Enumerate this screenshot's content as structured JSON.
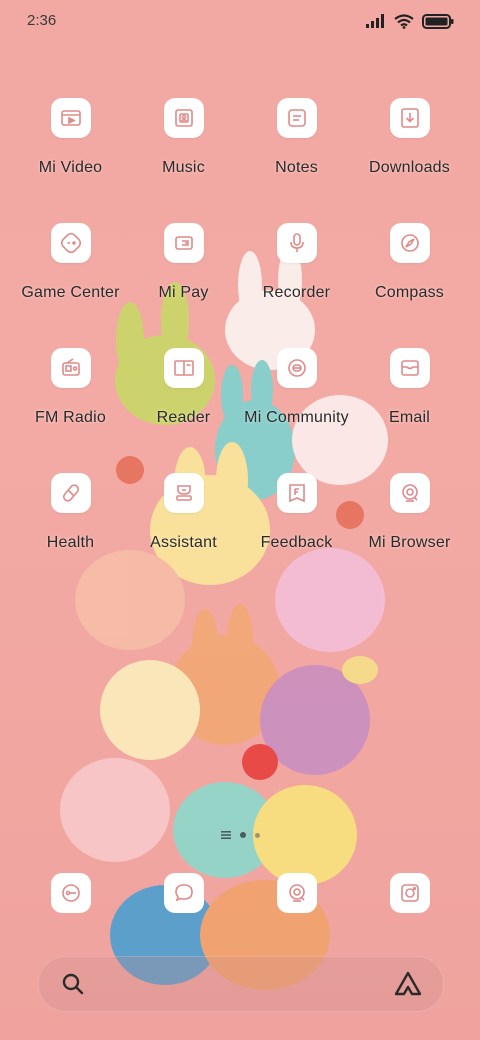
{
  "status_bar": {
    "time": "2:36"
  },
  "apps": [
    {
      "label": "Mi Video",
      "icon": "video-icon"
    },
    {
      "label": "Music",
      "icon": "music-icon"
    },
    {
      "label": "Notes",
      "icon": "notes-icon"
    },
    {
      "label": "Downloads",
      "icon": "download-icon"
    },
    {
      "label": "Game Center",
      "icon": "gamepad-icon"
    },
    {
      "label": "Mi Pay",
      "icon": "wallet-icon"
    },
    {
      "label": "Recorder",
      "icon": "microphone-icon"
    },
    {
      "label": "Compass",
      "icon": "compass-icon"
    },
    {
      "label": "FM Radio",
      "icon": "radio-icon"
    },
    {
      "label": "Reader",
      "icon": "book-icon"
    },
    {
      "label": "Mi Community",
      "icon": "community-icon"
    },
    {
      "label": "Email",
      "icon": "mail-icon"
    },
    {
      "label": "Health",
      "icon": "pill-icon"
    },
    {
      "label": "Assistant",
      "icon": "assistant-icon"
    },
    {
      "label": "Feedback",
      "icon": "feedback-icon"
    },
    {
      "label": "Mi Browser",
      "icon": "browser-icon"
    }
  ],
  "dock": [
    {
      "icon": "phone-icon"
    },
    {
      "icon": "message-icon"
    },
    {
      "icon": "browser-icon"
    },
    {
      "icon": "camera-icon"
    }
  ],
  "search": {
    "search_icon": "search-icon",
    "assistant_icon": "assistant-logo-icon"
  },
  "colors": {
    "background": "#f2a8a3",
    "icon_stroke": "#e08a8a",
    "tile": "#ffffff"
  }
}
